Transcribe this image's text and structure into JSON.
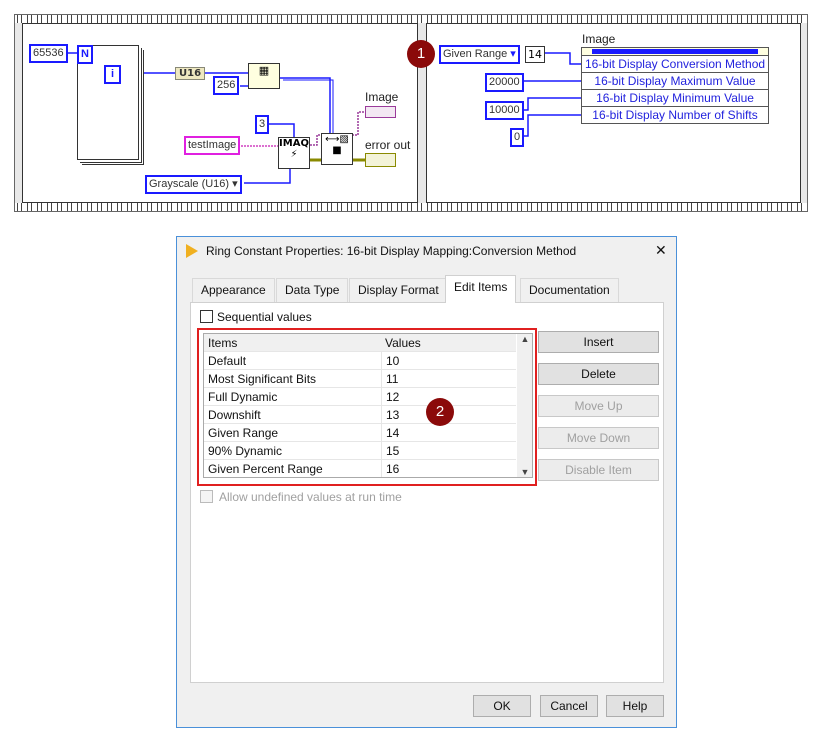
{
  "diagram": {
    "left": {
      "n_const": "65536",
      "n_terminal": "N",
      "i_terminal": "i",
      "u16_coerce": "U16",
      "reshape_dim": "256",
      "plane_const": "3",
      "image_name": "testImage",
      "image_type": "Grayscale (U16)",
      "imaq_label": "IMAQ",
      "image_indicator": "Image",
      "error_indicator": "error out"
    },
    "right": {
      "ring_value": "Given Range",
      "ring_numeric": "14",
      "max_const": "20000",
      "min_const": "10000",
      "shifts_const": "0",
      "node_label": "Image",
      "properties": [
        "16-bit Display Conversion Method",
        "16-bit Display Maximum Value",
        "16-bit Display Minimum Value",
        "16-bit Display Number of Shifts"
      ]
    },
    "callout1": "1"
  },
  "dialog": {
    "title": "Ring Constant Properties: 16-bit Display Mapping:Conversion Method",
    "close": "✕",
    "tabs": [
      "Appearance",
      "Data Type",
      "Display Format",
      "Edit Items",
      "Documentation"
    ],
    "active_tab": "Edit Items",
    "sequential_label": "Sequential values",
    "sequential_checked": false,
    "table": {
      "headers": [
        "Items",
        "Values"
      ],
      "rows": [
        [
          "Default",
          "10"
        ],
        [
          "Most Significant Bits",
          "11"
        ],
        [
          "Full Dynamic",
          "12"
        ],
        [
          "Downshift",
          "13"
        ],
        [
          "Given Range",
          "14"
        ],
        [
          "90% Dynamic",
          "15"
        ],
        [
          "Given Percent Range",
          "16"
        ]
      ]
    },
    "side_buttons": {
      "insert": "Insert",
      "delete": "Delete",
      "move_up": "Move Up",
      "move_down": "Move Down",
      "disable": "Disable Item"
    },
    "allow_undefined_label": "Allow undefined values at run time",
    "callout2": "2",
    "footer": {
      "ok": "OK",
      "cancel": "Cancel",
      "help": "Help"
    },
    "highlight_color": "#e02020"
  }
}
